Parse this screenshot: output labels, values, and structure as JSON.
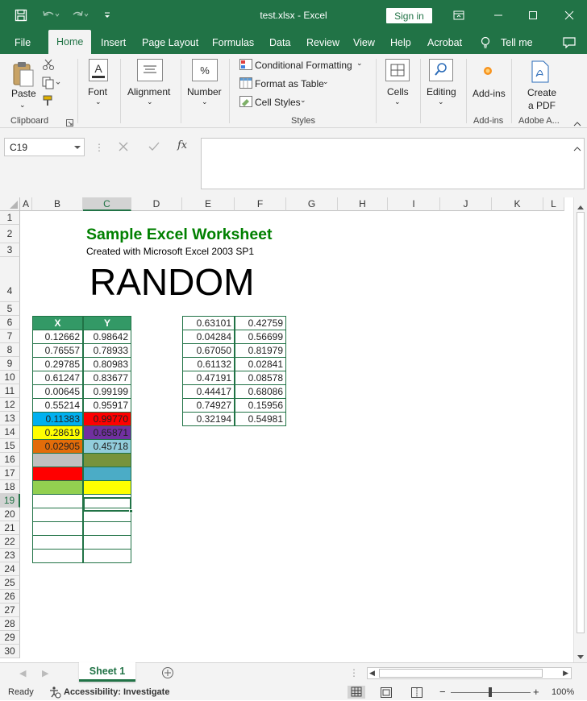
{
  "window": {
    "title": "test.xlsx  -  Excel",
    "sign_in": "Sign in"
  },
  "tabs": [
    "File",
    "Home",
    "Insert",
    "Page Layout",
    "Formulas",
    "Data",
    "Review",
    "View",
    "Help",
    "Acrobat",
    "Tell me"
  ],
  "active_tab": "Home",
  "ribbon": {
    "paste": "Paste",
    "clipboard": "Clipboard",
    "font": "Font",
    "alignment": "Alignment",
    "number": "Number",
    "conditional_formatting": "Conditional Formatting",
    "format_as_table": "Format as Table",
    "cell_styles": "Cell Styles",
    "styles": "Styles",
    "cells": "Cells",
    "editing": "Editing",
    "addins": "Add-ins",
    "addins_group": "Add-ins",
    "create_pdf_1": "Create",
    "create_pdf_2": "a PDF",
    "adobe_group": "Adobe A..."
  },
  "name_box": "C19",
  "columns": [
    "A",
    "B",
    "C",
    "D",
    "E",
    "F",
    "G",
    "H",
    "I",
    "J",
    "K",
    "L"
  ],
  "rows": [
    "1",
    "2",
    "3",
    "4",
    "5",
    "6",
    "7",
    "8",
    "9",
    "10",
    "11",
    "12",
    "13",
    "14",
    "15",
    "16",
    "17",
    "18",
    "19",
    "20",
    "21",
    "22",
    "23",
    "24",
    "25",
    "26",
    "27",
    "28",
    "29",
    "30"
  ],
  "sheet": {
    "heading": "Sample Excel Worksheet",
    "subheading": "Created with Microsoft Excel 2003 SP1",
    "big_text": "RANDOM",
    "table1": {
      "headers": [
        "X",
        "Y"
      ],
      "rows": [
        [
          "0.12662",
          "0.98642"
        ],
        [
          "0.76557",
          "0.78933"
        ],
        [
          "0.29785",
          "0.80983"
        ],
        [
          "0.61247",
          "0.83677"
        ],
        [
          "0.00645",
          "0.99199"
        ],
        [
          "0.55214",
          "0.95917"
        ],
        [
          "0.11383",
          "0.99770"
        ],
        [
          "0.28619",
          "0.65871"
        ],
        [
          "0.02905",
          "0.45718"
        ],
        [
          "",
          ""
        ],
        [
          "",
          ""
        ],
        [
          "",
          ""
        ],
        [
          "",
          ""
        ],
        [
          "",
          ""
        ],
        [
          "",
          ""
        ],
        [
          "",
          ""
        ],
        [
          "",
          ""
        ]
      ],
      "fills": [
        [
          "",
          ""
        ],
        [
          "",
          ""
        ],
        [
          "",
          ""
        ],
        [
          "",
          ""
        ],
        [
          "",
          ""
        ],
        [
          "",
          ""
        ],
        [
          "#00b0f0",
          "#ff0000"
        ],
        [
          "#ffff00",
          "#7030a0"
        ],
        [
          "#e36c09",
          "#92cddc"
        ],
        [
          "#c0c0c0",
          "#77933c"
        ],
        [
          "#ff0000",
          "#4bacc6"
        ],
        [
          "#92d050",
          "#ffff00"
        ],
        [
          "",
          ""
        ],
        [
          "",
          ""
        ],
        [
          "",
          ""
        ],
        [
          "",
          ""
        ],
        [
          "",
          ""
        ]
      ]
    },
    "table2": {
      "rows": [
        [
          "0.63101",
          "0.42759"
        ],
        [
          "0.04284",
          "0.56699"
        ],
        [
          "0.67050",
          "0.81979"
        ],
        [
          "0.61132",
          "0.02841"
        ],
        [
          "0.47191",
          "0.08578"
        ],
        [
          "0.44417",
          "0.68086"
        ],
        [
          "0.74927",
          "0.15956"
        ],
        [
          "0.32194",
          "0.54981"
        ]
      ]
    }
  },
  "sheet_tab": "Sheet 1",
  "status": {
    "ready": "Ready",
    "accessibility": "Accessibility: Investigate",
    "zoom": "100%"
  },
  "colors": {
    "accent": "#217346",
    "heading": "#008000"
  }
}
